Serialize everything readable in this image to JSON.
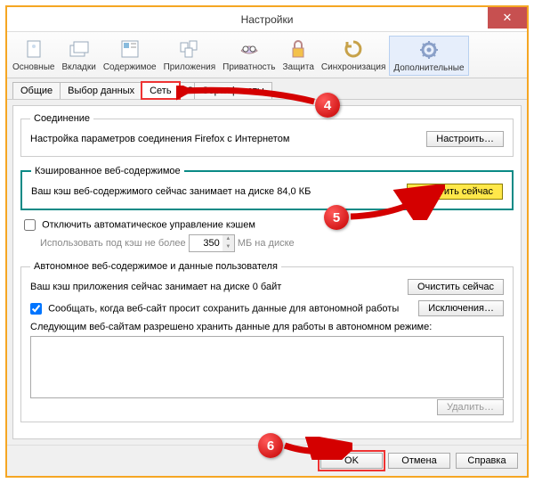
{
  "window": {
    "title": "Настройки"
  },
  "ribbon": [
    {
      "label": "Основные",
      "icon": "general-icon"
    },
    {
      "label": "Вкладки",
      "icon": "tabs-icon"
    },
    {
      "label": "Содержимое",
      "icon": "content-icon"
    },
    {
      "label": "Приложения",
      "icon": "apps-icon"
    },
    {
      "label": "Приватность",
      "icon": "privacy-icon"
    },
    {
      "label": "Защита",
      "icon": "security-icon"
    },
    {
      "label": "Синхронизация",
      "icon": "sync-icon"
    },
    {
      "label": "Дополнительные",
      "icon": "advanced-icon"
    }
  ],
  "sub_tabs": {
    "t0": "Общие",
    "t1": "Выбор данных",
    "t2": "Сеть",
    "t3": "Обновления",
    "t4": "Сертификаты"
  },
  "connection": {
    "legend": "Соединение",
    "text": "Настройка параметров соединения Firefox с Интернетом",
    "btn": "Настроить…"
  },
  "cache": {
    "legend": "Кэшированное веб-содержимое",
    "status": "Ваш кэш веб-содержимого сейчас занимает на диске 84,0 КБ",
    "clear_btn": "Очистить сейчас",
    "override_label": "Отключить автоматическое управление кэшем",
    "limit_prefix": "Использовать под кэш не более",
    "limit_value": "350",
    "limit_suffix": "МБ на диске"
  },
  "offline": {
    "legend": "Автономное веб-содержимое и данные пользователя",
    "status": "Ваш кэш приложения сейчас занимает на диске 0 байт",
    "clear_btn": "Очистить сейчас",
    "notify_label": "Сообщать, когда веб-сайт просит сохранить данные для автономной работы",
    "exceptions_btn": "Исключения…",
    "list_label": "Следующим веб-сайтам разрешено хранить данные для работы в автономном режиме:",
    "remove_btn": "Удалить…"
  },
  "footer": {
    "ok": "OK",
    "cancel": "Отмена",
    "help": "Справка"
  },
  "steps": {
    "s4": "4",
    "s5": "5",
    "s6": "6"
  }
}
